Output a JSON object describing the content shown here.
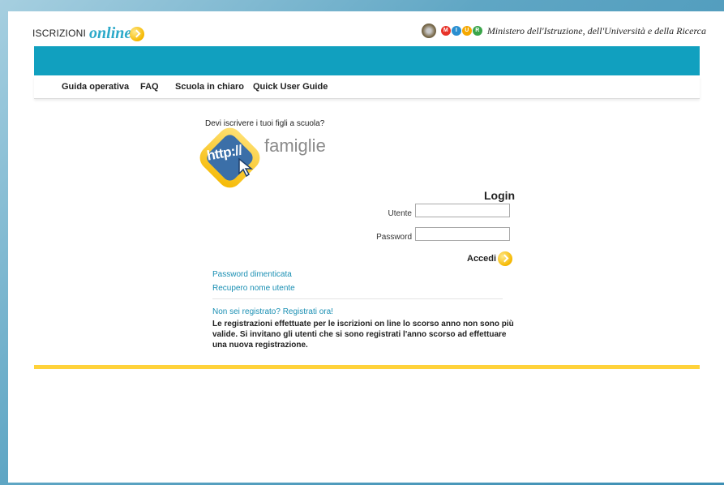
{
  "header": {
    "brand_prefix": "ISCRIZIONI",
    "brand_online": "online",
    "ministry_name": "Ministero dell'Istruzione, dell'Università e della Ricerca",
    "miur_letters": [
      "M",
      "I",
      "U",
      "R"
    ],
    "miur_colors": [
      "#e8332a",
      "#2a8fd0",
      "#f5a800",
      "#3aa54a"
    ]
  },
  "nav": {
    "items": [
      {
        "label": "Guida operativa"
      },
      {
        "label": "FAQ"
      },
      {
        "label": "Scuola in chiaro"
      },
      {
        "label": "Quick User Guide"
      }
    ]
  },
  "intro": {
    "question": "Devi iscrivere i tuoi figli a scuola?",
    "logo_http": "http://",
    "logo_text": "famiglie"
  },
  "login": {
    "title": "Login",
    "username_label": "Utente",
    "username_value": "",
    "password_label": "Password",
    "password_value": "",
    "submit_label": "Accedi"
  },
  "links": {
    "forgot_password": "Password dimenticata",
    "recover_username": "Recupero nome utente",
    "register": "Non sei registrato? Registrati ora!"
  },
  "notice": "Le registrazioni effettuate per le iscrizioni on line lo scorso anno non sono più valide. Si invitano gli utenti che si sono registrati l'anno scorso ad effettuare una nuova registrazione.",
  "colors": {
    "teal": "#11a0bf",
    "yellow": "#ffd23a",
    "link": "#1a8fb3"
  }
}
